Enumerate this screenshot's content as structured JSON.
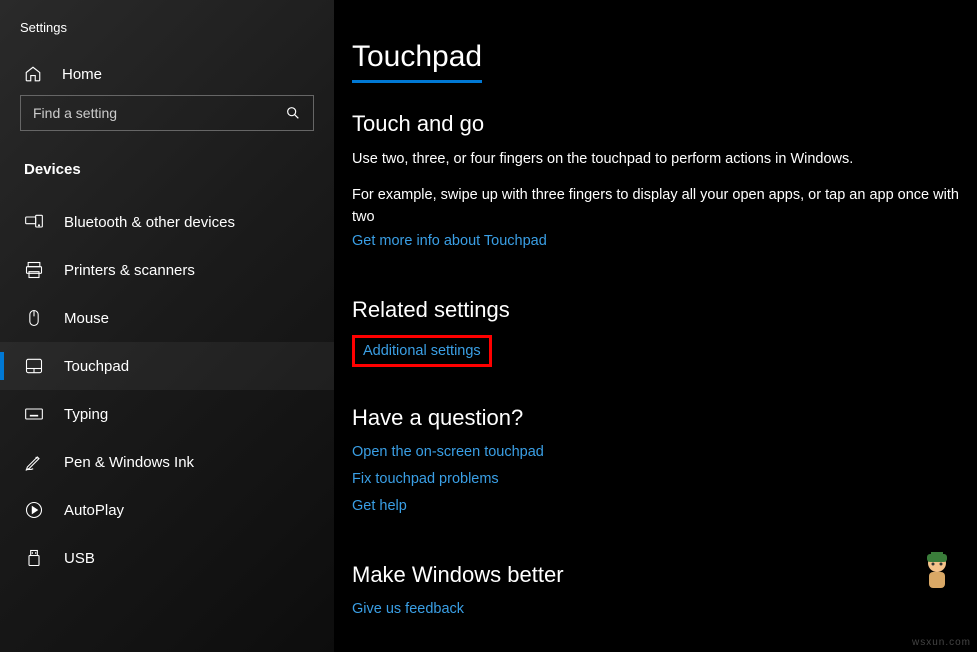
{
  "app_title": "Settings",
  "home_label": "Home",
  "search_placeholder": "Find a setting",
  "category_label": "Devices",
  "nav": [
    {
      "label": "Bluetooth & other devices",
      "icon": "bluetooth-devices-icon"
    },
    {
      "label": "Printers & scanners",
      "icon": "printer-icon"
    },
    {
      "label": "Mouse",
      "icon": "mouse-icon"
    },
    {
      "label": "Touchpad",
      "icon": "touchpad-icon",
      "active": true
    },
    {
      "label": "Typing",
      "icon": "keyboard-icon"
    },
    {
      "label": "Pen & Windows Ink",
      "icon": "pen-icon"
    },
    {
      "label": "AutoPlay",
      "icon": "autoplay-icon"
    },
    {
      "label": "USB",
      "icon": "usb-icon"
    }
  ],
  "page_title": "Touchpad",
  "sections": {
    "touch_and_go": {
      "heading": "Touch and go",
      "line1": "Use two, three, or four fingers on the touchpad to perform actions in Windows.",
      "line2": "For example, swipe up with three fingers to display all your open apps, or tap an app once with two",
      "link": "Get more info about Touchpad"
    },
    "related": {
      "heading": "Related settings",
      "link": "Additional settings"
    },
    "question": {
      "heading": "Have a question?",
      "links": [
        "Open the on-screen touchpad",
        "Fix touchpad problems",
        "Get help"
      ]
    },
    "better": {
      "heading": "Make Windows better",
      "link": "Give us feedback"
    }
  },
  "watermark": "wsxun.com"
}
